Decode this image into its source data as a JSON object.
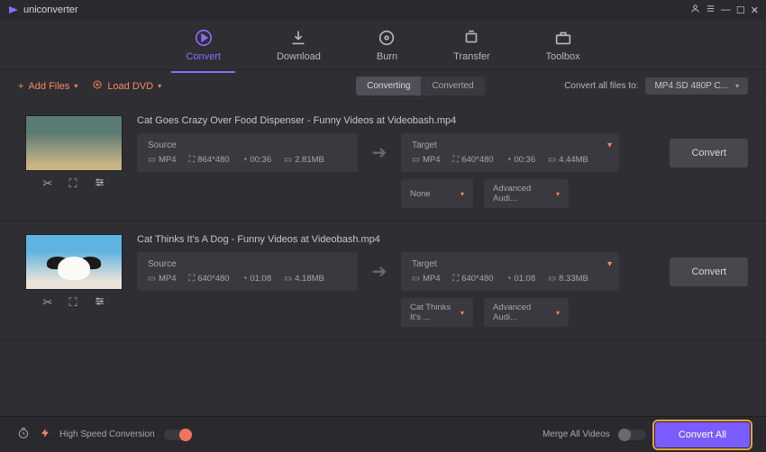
{
  "app": {
    "title": "uniconverter"
  },
  "window_buttons": {
    "user": "⛭",
    "settings": "≡",
    "min": "—",
    "max": "☐",
    "close": "✕"
  },
  "nav": {
    "items": [
      {
        "label": "Convert",
        "icon": "play-circle"
      },
      {
        "label": "Download",
        "icon": "download"
      },
      {
        "label": "Burn",
        "icon": "disc"
      },
      {
        "label": "Transfer",
        "icon": "transfer"
      },
      {
        "label": "Toolbox",
        "icon": "toolbox"
      }
    ],
    "active": 0
  },
  "toolbar": {
    "add_files": "Add Files",
    "load_dvd": "Load DVD",
    "tabs": {
      "converting": "Converting",
      "converted": "Converted",
      "active": "converting"
    },
    "convert_all_label": "Convert all files to:",
    "format_selected": "MP4 SD 480P C..."
  },
  "files": [
    {
      "name": "Cat Goes Crazy Over Food Dispenser - Funny Videos at Videobash.mp4",
      "source": {
        "label": "Source",
        "fmt": "MP4",
        "res": "864*480",
        "dur": "00:36",
        "size": "2.81MB"
      },
      "target": {
        "label": "Target",
        "fmt": "MP4",
        "res": "640*480",
        "dur": "00:36",
        "size": "4.44MB"
      },
      "subs": "None",
      "audio": "Advanced Audi...",
      "convert_label": "Convert"
    },
    {
      "name": "Cat Thinks It's A Dog - Funny Videos at Videobash.mp4",
      "source": {
        "label": "Source",
        "fmt": "MP4",
        "res": "640*480",
        "dur": "01:08",
        "size": "4.18MB"
      },
      "target": {
        "label": "Target",
        "fmt": "MP4",
        "res": "640*480",
        "dur": "01:08",
        "size": "8.33MB"
      },
      "subs": "Cat Thinks It's ...",
      "audio": "Advanced Audi...",
      "convert_label": "Convert"
    }
  ],
  "footer": {
    "high_speed": "High Speed Conversion",
    "high_speed_on": true,
    "merge_label": "Merge All Videos",
    "merge_on": false,
    "convert_all": "Convert All"
  }
}
